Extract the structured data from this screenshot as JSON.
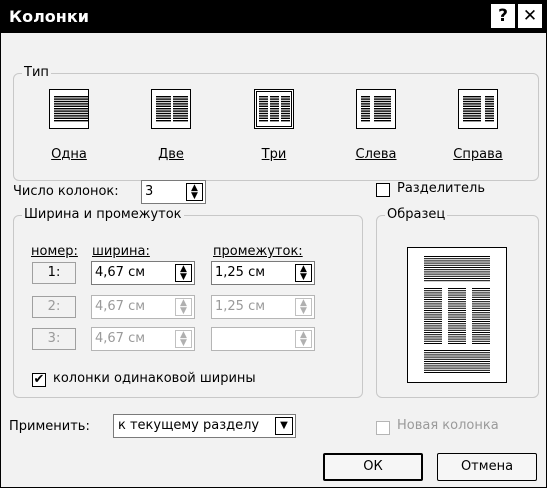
{
  "window": {
    "title": "Колонки",
    "help_label": "?",
    "close_label": "✕"
  },
  "type_group": {
    "legend": "Тип",
    "presets": [
      {
        "label": "Одна",
        "selected": false
      },
      {
        "label": "Две",
        "selected": false
      },
      {
        "label": "Три",
        "selected": true
      },
      {
        "label": "Слева",
        "selected": false
      },
      {
        "label": "Справа",
        "selected": false
      }
    ]
  },
  "columns_count": {
    "label": "Число колонок:",
    "value": "3"
  },
  "separator": {
    "label": "Разделитель",
    "checked": false
  },
  "width_spacing": {
    "legend": "Ширина и промежуток",
    "header_number": "номер:",
    "header_width": "ширина:",
    "header_spacing": "промежуток:",
    "rows": [
      {
        "number": "1:",
        "width": "4,67 см",
        "spacing": "1,25 см",
        "enabled": true
      },
      {
        "number": "2:",
        "width": "4,67 см",
        "spacing": "1,25 см",
        "enabled": false
      },
      {
        "number": "3:",
        "width": "4,67 см",
        "spacing": "",
        "enabled": false
      }
    ],
    "equal_width_label": "колонки одинаковой ширины",
    "equal_width_checked": true,
    "checkmark": "✔"
  },
  "preview": {
    "legend": "Образец"
  },
  "apply": {
    "label": "Применить:",
    "value": "к текущему разделу"
  },
  "new_column": {
    "label": "Новая колонка",
    "checked": false
  },
  "buttons": {
    "ok": "ОК",
    "cancel": "Отмена"
  },
  "icons": {
    "spin_up": "▲",
    "spin_down": "▼",
    "dropdown": "▼"
  }
}
